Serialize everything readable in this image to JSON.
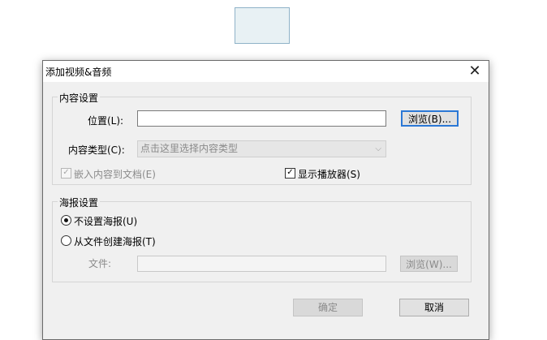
{
  "dialog": {
    "title": "添加视频&音频",
    "close_glyph": "✕"
  },
  "content_settings": {
    "group_label": "内容设置",
    "location_label": "位置(L):",
    "location_value": "",
    "browse_label": "浏览(B)...",
    "content_type_label": "内容类型(C):",
    "content_type_value": "点击这里选择内容类型",
    "embed_label": "嵌入内容到文档(E)",
    "embed_checked": true,
    "show_player_label": "显示播放器(S)",
    "show_player_checked": true,
    "check_glyph": "✓"
  },
  "poster_settings": {
    "group_label": "海报设置",
    "no_poster_label": "不设置海报(U)",
    "from_file_label": "从文件创建海报(T)",
    "file_label": "文件:",
    "file_value": "",
    "browse_label": "浏览(W)..."
  },
  "footer": {
    "ok_label": "确定",
    "cancel_label": "取消"
  }
}
